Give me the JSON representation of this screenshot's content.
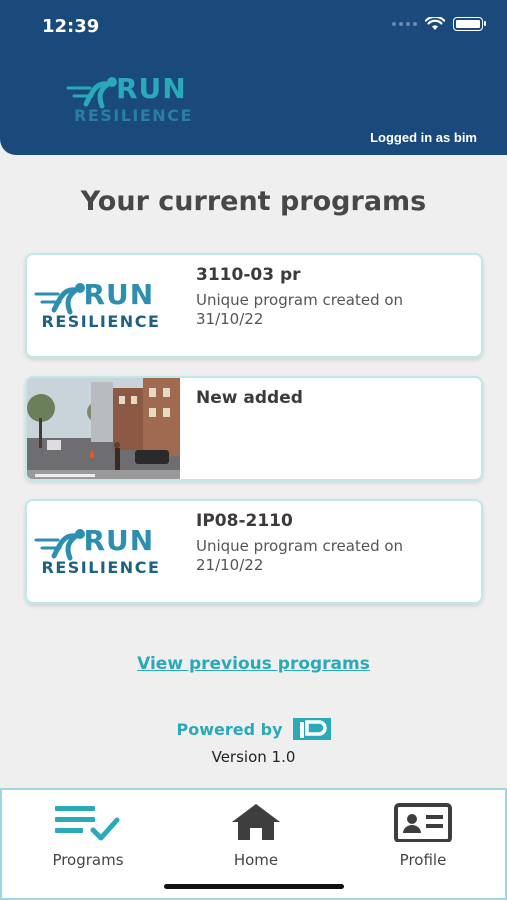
{
  "status_bar": {
    "time": "12:39"
  },
  "header": {
    "logo": {
      "top": "RUN",
      "bottom": "RESILIENCE"
    },
    "logged_in_text": "Logged in as bim"
  },
  "page_title": "Your current programs",
  "programs": [
    {
      "title": "3110-03 pr",
      "subtitle": "Unique program created on 31/10/22",
      "thumbnail": "run-resilience-logo"
    },
    {
      "title": "New added",
      "subtitle": "",
      "thumbnail": "street-photo"
    },
    {
      "title": "IP08-2110",
      "subtitle": "Unique program created on 21/10/22",
      "thumbnail": "run-resilience-logo"
    }
  ],
  "view_previous": "View previous programs",
  "powered_by": "Powered by",
  "version": "Version 1.0",
  "tabs": [
    {
      "label": "Programs",
      "icon": "programs-list-icon"
    },
    {
      "label": "Home",
      "icon": "home-icon"
    },
    {
      "label": "Profile",
      "icon": "profile-card-icon"
    }
  ],
  "colors": {
    "header_bg": "#1a4a7c",
    "accent": "#2aa9b8",
    "page_bg": "#efefef"
  }
}
